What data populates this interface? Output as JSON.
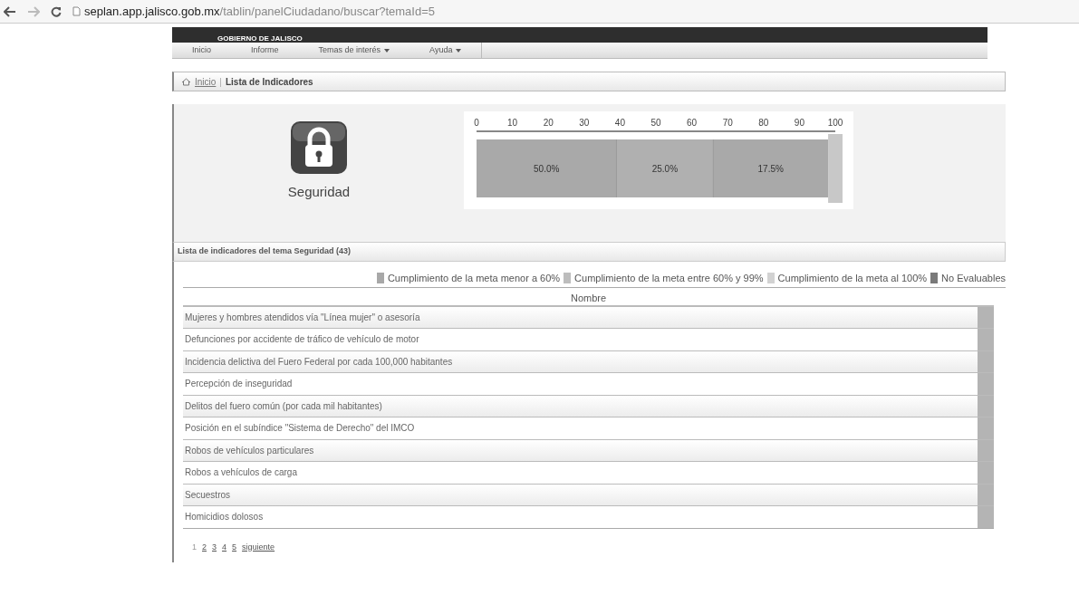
{
  "browser": {
    "url_host": "seplan.app.jalisco.gob.mx",
    "url_path": "/tablin/panelCiudadano/buscar?temaId=5"
  },
  "header": {
    "logo_text": "GOBIERNO DE JALISCO"
  },
  "nav": [
    {
      "label": "Inicio",
      "has_menu": false
    },
    {
      "label": "Informe",
      "has_menu": false
    },
    {
      "label": "Temas de interés",
      "has_menu": true
    },
    {
      "label": "Ayuda",
      "has_menu": true
    }
  ],
  "breadcrumb": {
    "home": "Inicio",
    "separator": "|",
    "current": "Lista de Indicadores"
  },
  "topic": {
    "name": "Seguridad"
  },
  "chart_data": {
    "type": "bar",
    "orientation": "horizontal",
    "stacked": true,
    "categories": [
      null
    ],
    "xlim": [
      0,
      100
    ],
    "xticks": [
      0,
      10,
      20,
      30,
      40,
      50,
      60,
      70,
      80,
      90,
      100
    ],
    "series": [
      {
        "values": [
          39
        ]
      },
      {
        "values": [
          27
        ]
      },
      {
        "values": [
          32
        ]
      }
    ],
    "value_labels": [
      "50.0%",
      "25.0%",
      "17.5%"
    ]
  },
  "list": {
    "title": "Lista de indicadores del tema Seguridad (43)",
    "legend": [
      {
        "label": "Cumplimiento de la meta menor a 60%",
        "color": "#a8a8a8"
      },
      {
        "label": "Cumplimiento de la meta entre 60% y 99%",
        "color": "#bdbdbd"
      },
      {
        "label": "Cumplimiento de la meta al 100%",
        "color": "#d2d2d2"
      },
      {
        "label": "No Evaluables",
        "color": "#7a7a7a"
      }
    ],
    "column": "Nombre",
    "rows": [
      {
        "name": "Mujeres y hombres atendidos vía \"Línea mujer\" o asesoría",
        "color": "#b4b4b4"
      },
      {
        "name": "Defunciones por accidente de tráfico de vehículo de motor",
        "color": "#b4b4b4"
      },
      {
        "name": "Incidencia delictiva del Fuero Federal por cada 100,000 habitantes",
        "color": "#b4b4b4"
      },
      {
        "name": "Percepción de inseguridad",
        "color": "#b4b4b4"
      },
      {
        "name": "Delitos del fuero común (por cada mil habitantes)",
        "color": "#b4b4b4"
      },
      {
        "name": "Posición en el subíndice \"Sistema de Derecho\" del IMCO",
        "color": "#b4b4b4"
      },
      {
        "name": "Robos de vehículos particulares",
        "color": "#b4b4b4"
      },
      {
        "name": "Robos a vehículos de carga",
        "color": "#b4b4b4"
      },
      {
        "name": "Secuestros",
        "color": "#b4b4b4"
      },
      {
        "name": "Homicidios dolosos",
        "color": "#b4b4b4"
      }
    ],
    "pages": [
      {
        "label": "1",
        "selected": true
      },
      {
        "label": "2",
        "selected": false
      },
      {
        "label": "3",
        "selected": false
      },
      {
        "label": "4",
        "selected": false
      },
      {
        "label": "5",
        "selected": false
      }
    ],
    "next": "siguiente"
  }
}
